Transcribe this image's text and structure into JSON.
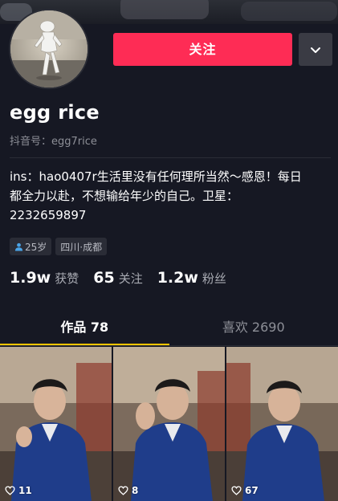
{
  "profile": {
    "nickname": "egg rice",
    "douyin_id": "抖音号：egg7rice",
    "bio_lines": [
      "ins：hao0407r生活里没有任何理所当然～感恩！每日",
      "都全力以赴，不想输给年少的自己。卫星：",
      "2232659897"
    ],
    "tags": {
      "age": "25岁",
      "location": "四川·成都"
    }
  },
  "actions": {
    "follow_label": "关注",
    "more_icon": "chevron-down-icon"
  },
  "stats": [
    {
      "num": "1.9w",
      "label": "获赞"
    },
    {
      "num": "65",
      "label": "关注"
    },
    {
      "num": "1.2w",
      "label": "粉丝"
    }
  ],
  "tabs": [
    {
      "label": "作品 78",
      "active": true
    },
    {
      "label": "喜欢 2690",
      "active": false
    }
  ],
  "videos": [
    {
      "likes": "11"
    },
    {
      "likes": "8"
    },
    {
      "likes": "67"
    }
  ],
  "colors": {
    "background": "#161823",
    "accent": "#fe2c55",
    "tab_indicator": "#fec500"
  }
}
